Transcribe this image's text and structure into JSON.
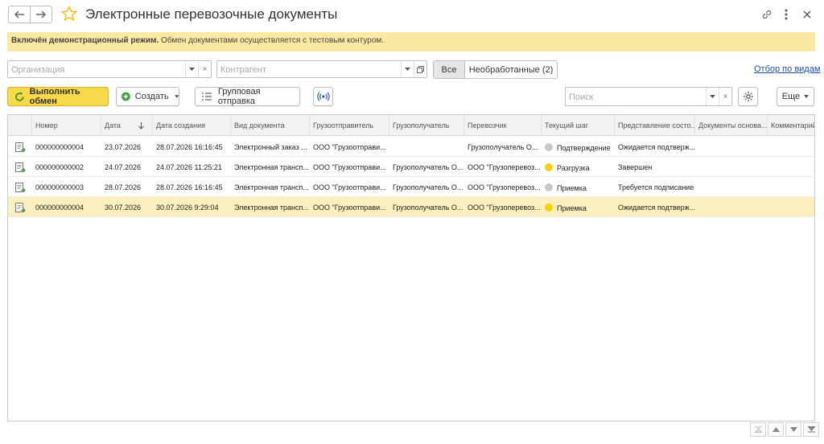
{
  "window": {
    "title": "Электронные перевозочные документы",
    "icons": [
      "back-arrow-icon",
      "forward-arrow-icon",
      "star-icon",
      "link-icon",
      "more-vertical-icon",
      "close-icon"
    ]
  },
  "banner": {
    "bold": "Включён демонстрационный режим.",
    "text": " Обмен документами осуществляется с тестовым контуром."
  },
  "filters": {
    "organization_placeholder": "Организация",
    "counterparty_placeholder": "Контрагент",
    "toggle_all": "Все",
    "toggle_unprocessed": "Необработанные (2)",
    "view_link": "Отбор по видам"
  },
  "toolbar": {
    "exchange": "Выполнить обмен",
    "create": "Создать",
    "group_send": "Групповая отправка",
    "search_placeholder": "Поиск",
    "more": "Еще"
  },
  "table": {
    "columns": [
      "Номер",
      "Дата",
      "Дата создания",
      "Вид документа",
      "Грузоотправитель",
      "Грузополучатель",
      "Перевозчик",
      "Текущий шаг",
      "Представление состо...",
      "Документы основа...",
      "Комментарий"
    ],
    "rows": [
      {
        "number": "000000000004",
        "date": "23.07.2026",
        "created": "28.07.2026 16:16:45",
        "doc_type": "Электронный заказ ...",
        "shipper": "ООО \"Грузоотправи...",
        "consignee": "",
        "carrier": "Грузополучатель О...",
        "step": "Подтверждение",
        "step_color": "#c8c8c8",
        "status": "Ожидается подтверж...",
        "base_docs": "",
        "comment": ""
      },
      {
        "number": "000000000002",
        "date": "24.07.2026",
        "created": "24.07.2026 11:25:21",
        "doc_type": "Электронная трансп...",
        "shipper": "ООО \"Грузоотправи...",
        "consignee": "Грузополучатель О...",
        "carrier": "ООО \"Грузоперевоз...",
        "step": "Разгрузка",
        "step_color": "#f5d20a",
        "status": "Завершен",
        "base_docs": "",
        "comment": ""
      },
      {
        "number": "000000000003",
        "date": "28.07.2026",
        "created": "28.07.2026 16:16:45",
        "doc_type": "Электронная трансп...",
        "shipper": "ООО \"Грузоотправи...",
        "consignee": "Грузополучатель О...",
        "carrier": "ООО \"Грузоперевоз...",
        "step": "Приемка",
        "step_color": "#c8c8c8",
        "status": "Требуется подписание",
        "base_docs": "",
        "comment": ""
      },
      {
        "number": "000000000004",
        "date": "30.07.2026",
        "created": "30.07.2026 9:29:04",
        "doc_type": "Электронная трансп...",
        "shipper": "ООО \"Грузоотправи...",
        "consignee": "Грузополучатель О...",
        "carrier": "ООО \"Грузоперевоз...",
        "step": "Приемка",
        "step_color": "#f5d20a",
        "status": "Ожидается подтверж...",
        "base_docs": "",
        "comment": ""
      }
    ]
  },
  "colors": {
    "banner_bg": "#fbe9a1",
    "primary_button": "#f8d94a",
    "selected_row": "#fbefbd",
    "link": "#1d4fa8"
  }
}
